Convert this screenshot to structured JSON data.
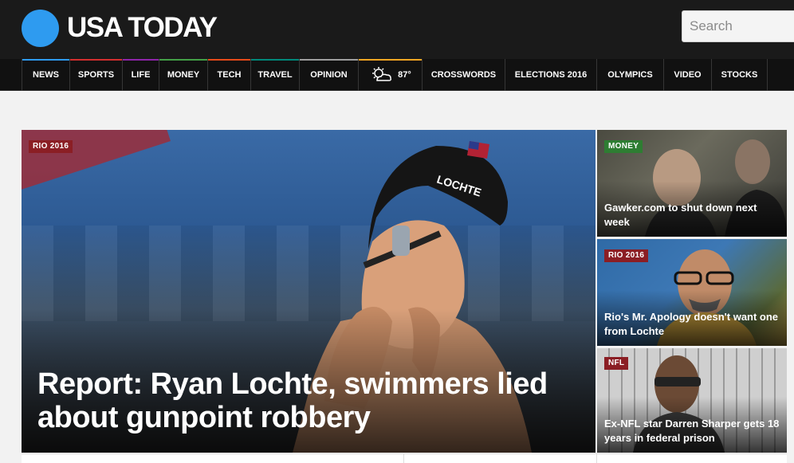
{
  "header": {
    "logo_text": "USA TODAY",
    "search_placeholder": "Search",
    "logo_color": "#2e9bf0"
  },
  "nav": {
    "items": [
      {
        "label": "NEWS",
        "accent": "#2e9bf0"
      },
      {
        "label": "SPORTS",
        "accent": "#d32f2f"
      },
      {
        "label": "LIFE",
        "accent": "#8e24aa"
      },
      {
        "label": "MONEY",
        "accent": "#43a047"
      },
      {
        "label": "TECH",
        "accent": "#e64a19"
      },
      {
        "label": "TRAVEL",
        "accent": "#00897b"
      },
      {
        "label": "OPINION",
        "accent": "#9e9e9e"
      }
    ],
    "weather": {
      "temp": "87°",
      "icon": "partly-cloudy-icon",
      "accent": "#f6a623"
    },
    "items_right": [
      {
        "label": "CROSSWORDS",
        "accent": "#111111"
      },
      {
        "label": "ELECTIONS 2016",
        "accent": "#111111"
      },
      {
        "label": "OLYMPICS",
        "accent": "#111111"
      },
      {
        "label": "VIDEO",
        "accent": "#111111"
      },
      {
        "label": "STOCKS",
        "accent": "#111111"
      }
    ]
  },
  "hero": {
    "tag": "RIO 2016",
    "headline": "Report: Ryan Lochte, swimmers lied about gunpoint robbery",
    "cap_text": "LOCHTE"
  },
  "cards": [
    {
      "tag": "MONEY",
      "title": "Gawker.com to shut down next week"
    },
    {
      "tag": "RIO 2016",
      "title": "Rio's Mr. Apology doesn't want one from Lochte"
    },
    {
      "tag": "NFL",
      "title": "Ex-NFL star Darren Sharper gets 18 years in federal prison"
    }
  ]
}
